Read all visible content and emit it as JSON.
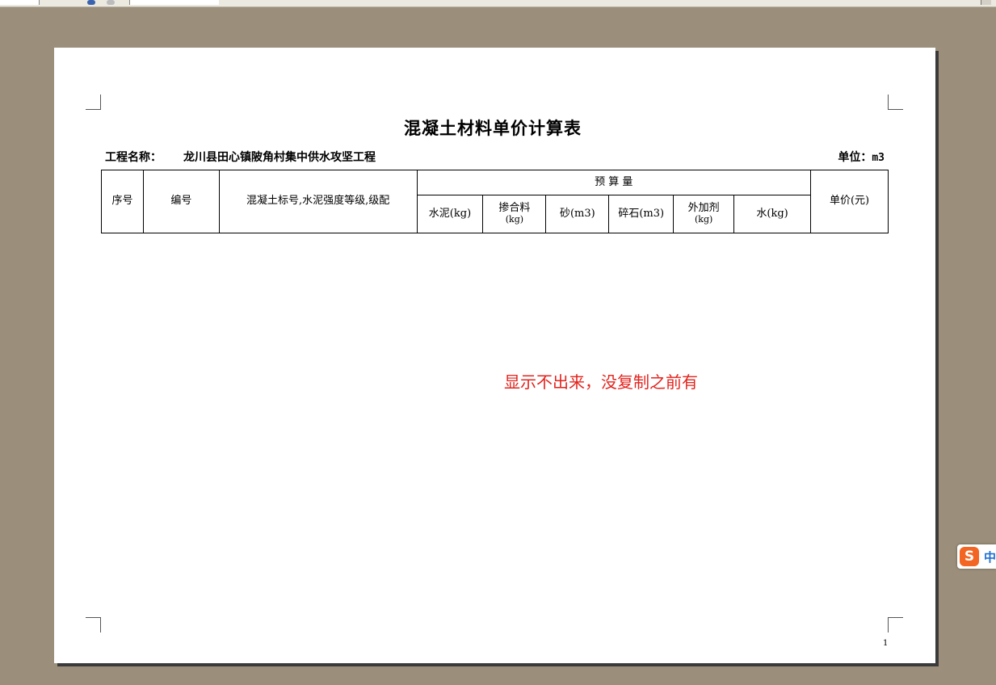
{
  "document": {
    "title": "混凝土材料单价计算表",
    "project_label": "工程名称：",
    "project_name": "龙川县田心镇陂角村集中供水攻坚工程",
    "unit_label": "单位：",
    "unit_value": "m3",
    "page_number": "1"
  },
  "table": {
    "col_seq": "序号",
    "col_code": "编号",
    "col_spec": "混凝土标号,水泥强度等级,级配",
    "col_budget_group": "预 算 量",
    "col_unit_price": "单价(元)",
    "sub_cement": "水泥(kg)",
    "sub_admix_line1": "掺合料",
    "sub_admix_line2": "(kg)",
    "sub_sand": "砂(m3)",
    "sub_gravel": "碎石(m3)",
    "sub_additive_line1": "外加剂",
    "sub_additive_line2": "(kg)",
    "sub_water": "水(kg)"
  },
  "annotation": {
    "text": "显示不出来，没复制之前有",
    "color": "#e3231d"
  },
  "ime": {
    "logo": "S",
    "mode": "中"
  },
  "colors": {
    "background": "#9b8f7b",
    "page": "#ffffff"
  }
}
